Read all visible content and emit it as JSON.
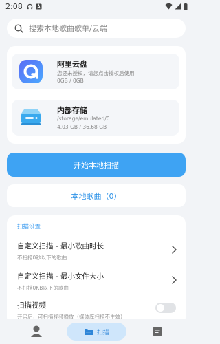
{
  "status_bar": {
    "time": "2:08"
  },
  "search": {
    "placeholder": "搜索本地歌曲歌单/云端"
  },
  "storage": {
    "aliyun": {
      "title": "阿里云盘",
      "subtitle": "您还未授权，请您点击授权后使用",
      "usage": "0GB / 0GB",
      "icon": "aliyun-drive-icon"
    },
    "internal": {
      "title": "内部存储",
      "path": "/storage/emulated/0",
      "usage": "4.03 GB / 36.68 GB",
      "icon": "hard-drive-icon"
    }
  },
  "actions": {
    "scan_label": "开始本地扫描",
    "local_songs_label": "本地歌曲（0）"
  },
  "settings": {
    "header": "扫描设置",
    "items": [
      {
        "title": "自定义扫描 - 最小歌曲时长",
        "desc": "不扫描0秒以下的歌曲",
        "control": "chevron"
      },
      {
        "title": "自定义扫描 - 最小文件大小",
        "desc": "不扫描0KB以下的歌曲",
        "control": "chevron"
      },
      {
        "title": "扫描视频",
        "desc": "开启后，可扫描视频播放（媒体库扫描不生效）",
        "control": "toggle",
        "enabled": false
      }
    ]
  },
  "bottom_nav": {
    "scan_label": "扫描"
  },
  "colors": {
    "accent": "#3ea3f3",
    "background": "#f2f4f7",
    "link": "#2e93e8"
  }
}
